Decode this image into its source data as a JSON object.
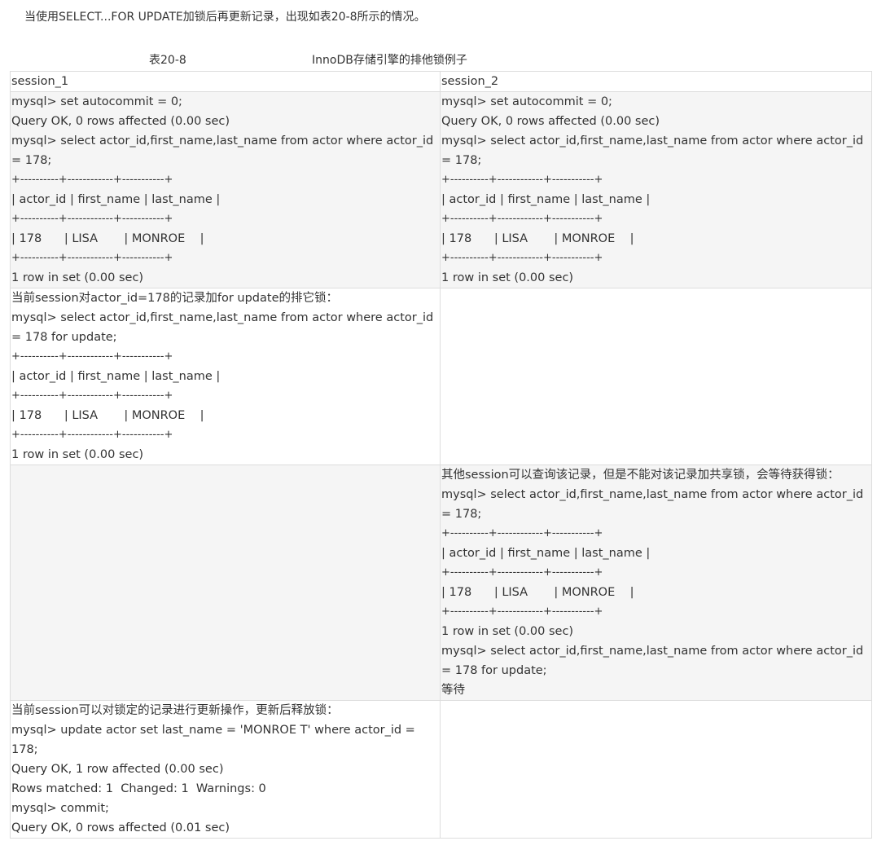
{
  "intro": "当使用SELECT...FOR UPDATE加锁后再更新记录，出现如表20-8所示的情况。",
  "caption": {
    "number": "表20-8",
    "title": "InnoDB存储引擎的排他锁例子"
  },
  "table": {
    "headers": [
      "session_1",
      "session_2"
    ],
    "rows": [
      {
        "session_1": [
          "mysql> set autocommit = 0;",
          "Query OK, 0 rows affected (0.00 sec)",
          "mysql> select actor_id,first_name,last_name from actor where actor_id = 178;",
          "+----------+------------+-----------+",
          "| actor_id | first_name | last_name |",
          "+----------+------------+-----------+",
          "| 178      | LISA       | MONROE    |",
          "+----------+------------+-----------+",
          "1 row in set (0.00 sec)"
        ],
        "session_2": [
          "mysql> set autocommit = 0;",
          "Query OK, 0 rows affected (0.00 sec)",
          "mysql> select actor_id,first_name,last_name from actor where actor_id = 178;",
          "+----------+------------+-----------+",
          "| actor_id | first_name | last_name |",
          "+----------+------------+-----------+",
          "| 178      | LISA       | MONROE    |",
          "+----------+------------+-----------+",
          "1 row in set (0.00 sec)"
        ]
      },
      {
        "session_1": [
          "当前session对actor_id=178的记录加for update的排它锁：",
          "mysql> select actor_id,first_name,last_name from actor where actor_id = 178 for update;",
          "+----------+------------+-----------+",
          "| actor_id | first_name | last_name |",
          "+----------+------------+-----------+",
          "| 178      | LISA       | MONROE    |",
          "+----------+------------+-----------+",
          "1 row in set (0.00 sec)"
        ],
        "session_2": []
      },
      {
        "session_1": [],
        "session_2": [
          "其他session可以查询该记录，但是不能对该记录加共享锁，会等待获得锁：",
          "mysql> select actor_id,first_name,last_name from actor where actor_id = 178;",
          "+----------+------------+-----------+",
          "| actor_id | first_name | last_name |",
          "+----------+------------+-----------+",
          "| 178      | LISA       | MONROE    |",
          "+----------+------------+-----------+",
          "1 row in set (0.00 sec)",
          "mysql> select actor_id,first_name,last_name from actor where actor_id = 178 for update;",
          "等待"
        ]
      },
      {
        "session_1": [
          "当前session可以对锁定的记录进行更新操作，更新后释放锁：",
          "mysql> update actor set last_name = 'MONROE T' where actor_id = 178;",
          "Query OK, 1 row affected (0.00 sec)",
          "Rows matched: 1  Changed: 1  Warnings: 0",
          "mysql> commit;",
          "Query OK, 0 rows affected (0.01 sec)"
        ],
        "session_2": []
      }
    ]
  }
}
